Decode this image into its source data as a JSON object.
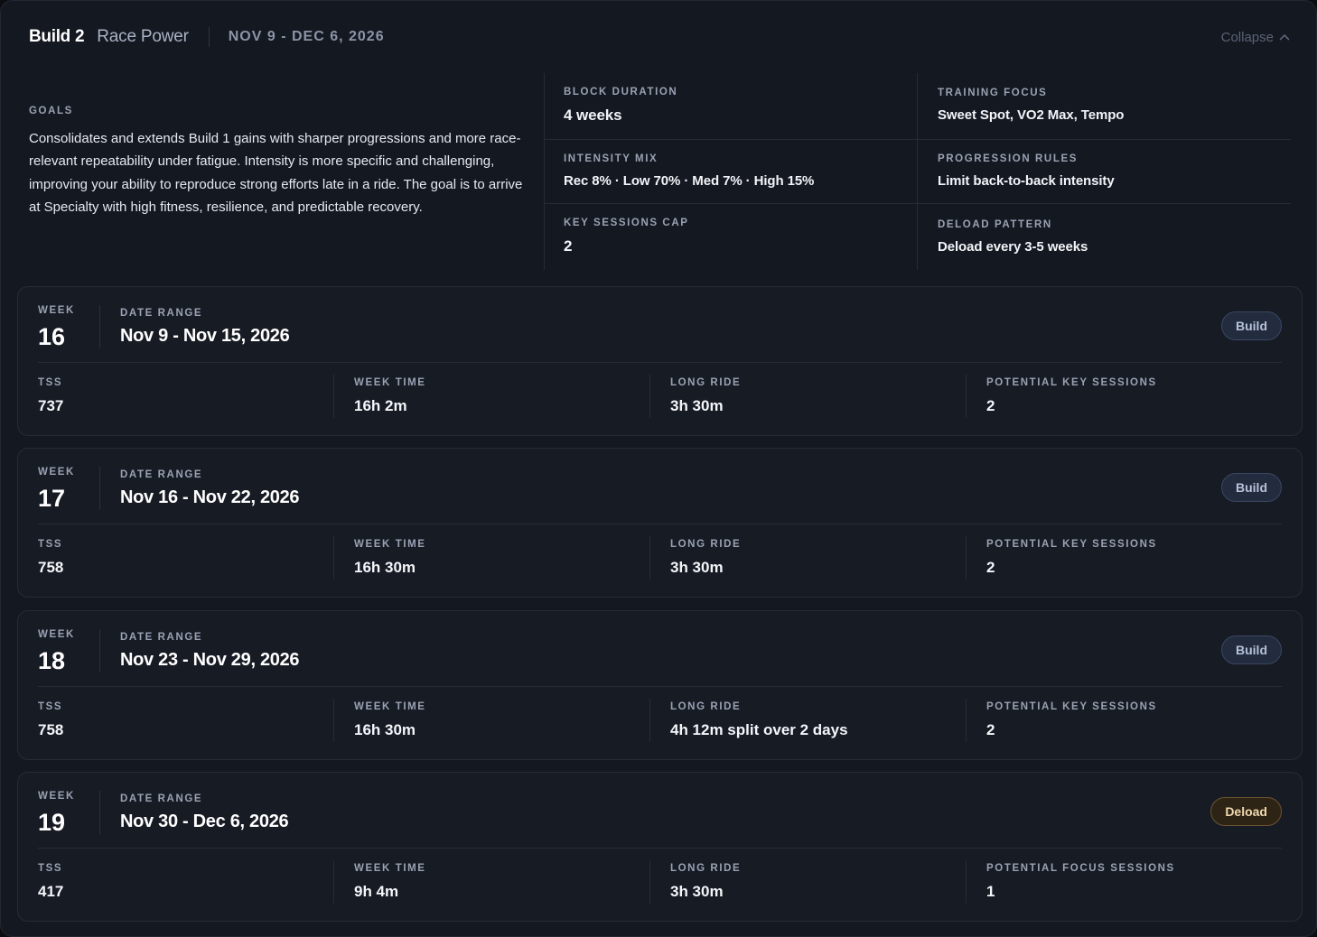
{
  "header": {
    "build": "Build 2",
    "name": "Race Power",
    "dates": "NOV 9 - DEC 6, 2026",
    "collapse_label": "Collapse"
  },
  "goals": {
    "label": "GOALS",
    "text": "Consolidates and extends Build 1 gains with sharper progressions and more race-relevant repeatability under fatigue. Intensity is more specific and challenging, improving your ability to reproduce strong efforts late in a ride. The goal is to arrive at Specialty with high fitness, resilience, and predictable recovery."
  },
  "stats": {
    "block_duration": {
      "label": "BLOCK DURATION",
      "value": "4 weeks"
    },
    "training_focus": {
      "label": "TRAINING FOCUS",
      "value": "Sweet Spot, VO2 Max, Tempo"
    },
    "intensity_mix": {
      "label": "INTENSITY MIX",
      "value": "Rec 8% · Low 70% · Med 7% · High 15%"
    },
    "progression_rules": {
      "label": "PROGRESSION RULES",
      "value": "Limit back-to-back intensity"
    },
    "key_sessions_cap": {
      "label": "KEY SESSIONS CAP",
      "value": "2"
    },
    "deload_pattern": {
      "label": "DELOAD PATTERN",
      "value": "Deload every 3-5 weeks"
    }
  },
  "labels": {
    "week": "WEEK",
    "date_range": "DATE RANGE",
    "tss": "TSS",
    "week_time": "WEEK TIME",
    "long_ride": "LONG RIDE"
  },
  "weeks": [
    {
      "week": "16",
      "date_range": "Nov 9 - Nov 15, 2026",
      "badge": "Build",
      "tss": "737",
      "week_time": "16h 2m",
      "long_ride": "3h 30m",
      "sessions_label": "POTENTIAL KEY SESSIONS",
      "sessions": "2"
    },
    {
      "week": "17",
      "date_range": "Nov 16 - Nov 22, 2026",
      "badge": "Build",
      "tss": "758",
      "week_time": "16h 30m",
      "long_ride": "3h 30m",
      "sessions_label": "POTENTIAL KEY SESSIONS",
      "sessions": "2"
    },
    {
      "week": "18",
      "date_range": "Nov 23 - Nov 29, 2026",
      "badge": "Build",
      "tss": "758",
      "week_time": "16h 30m",
      "long_ride": "4h 12m split over 2 days",
      "sessions_label": "POTENTIAL KEY SESSIONS",
      "sessions": "2"
    },
    {
      "week": "19",
      "date_range": "Nov 30 - Dec 6, 2026",
      "badge": "Deload",
      "tss": "417",
      "week_time": "9h 4m",
      "long_ride": "3h 30m",
      "sessions_label": "POTENTIAL FOCUS SESSIONS",
      "sessions": "1"
    }
  ],
  "colors": {
    "panel_bg": "#141821",
    "card_bg": "#171b24",
    "build_badge": "#232c3f",
    "deload_badge": "#2e2416",
    "deload_text": "#f0d9ad"
  }
}
